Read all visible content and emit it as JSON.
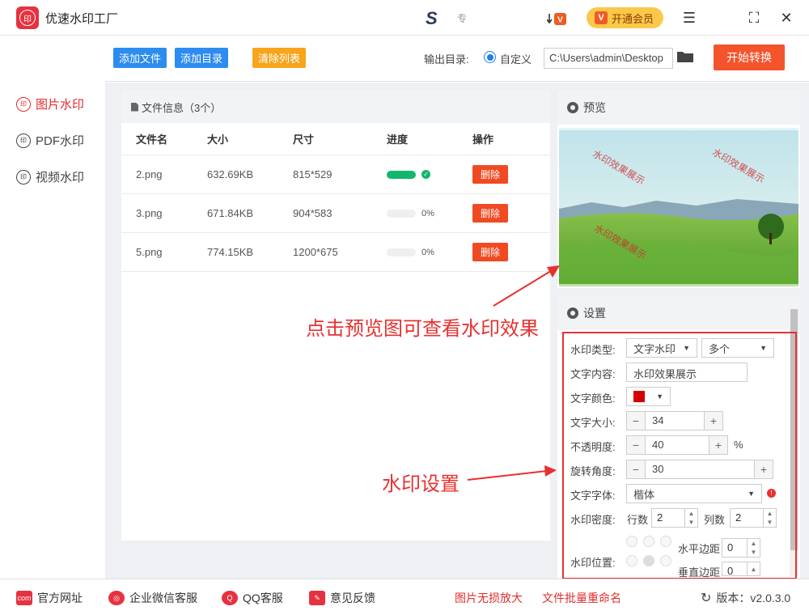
{
  "app": {
    "title": "优速水印工厂",
    "center_logo": "S",
    "center_text": "专"
  },
  "header": {
    "vip_label": "开通会员",
    "vip_badge": "V"
  },
  "sidebar": {
    "items": [
      {
        "label": "图片水印",
        "icon": "印",
        "active": true
      },
      {
        "label": "PDF水印",
        "icon": "印",
        "active": false
      },
      {
        "label": "视频水印",
        "icon": "印",
        "active": false
      }
    ]
  },
  "toolbar": {
    "add_file": "添加文件",
    "add_dir": "添加目录",
    "clear_list": "清除列表",
    "output_label": "输出目录:",
    "radio_label": "自定义",
    "output_path": "C:\\Users\\admin\\Desktop",
    "start": "开始转换"
  },
  "files": {
    "title": "文件信息（3个）",
    "columns": [
      "文件名",
      "大小",
      "尺寸",
      "进度",
      "操作"
    ],
    "rows": [
      {
        "name": "2.png",
        "size": "632.69KB",
        "dim": "815*529",
        "progress": 1.0,
        "pct": "",
        "action": "删除"
      },
      {
        "name": "3.png",
        "size": "671.84KB",
        "dim": "904*583",
        "progress": 0,
        "pct": "0%",
        "action": "删除"
      },
      {
        "name": "5.png",
        "size": "774.15KB",
        "dim": "1200*675",
        "progress": 0,
        "pct": "0%",
        "action": "删除"
      }
    ]
  },
  "preview": {
    "title": "预览",
    "watermark": "水印效果展示"
  },
  "settings": {
    "title": "设置",
    "type_label": "水印类型:",
    "type_value": "文字水印",
    "mode_value": "多个",
    "content_label": "文字内容:",
    "content_value": "水印效果展示",
    "color_label": "文字颜色:",
    "color_value": "#d40000",
    "size_label": "文字大小:",
    "size_value": "34",
    "opacity_label": "不透明度:",
    "opacity_value": "40",
    "opacity_unit": "%",
    "rotate_label": "旋转角度:",
    "rotate_value": "30",
    "font_label": "文字字体:",
    "font_value": "楷体",
    "density_label": "水印密度:",
    "rows_label": "行数",
    "rows_value": "2",
    "cols_label": "列数",
    "cols_value": "2",
    "position_label": "水印位置:",
    "hmargin_label": "水平边距",
    "hmargin_value": "0",
    "vmargin_label": "垂直边距",
    "vmargin_value": "0"
  },
  "annotations": {
    "preview_hint": "点击预览图可查看水印效果",
    "settings_hint": "水印设置"
  },
  "footer": {
    "website": "官方网址",
    "wechat": "企业微信客服",
    "qq": "QQ客服",
    "feedback": "意见反馈",
    "link1": "图片无损放大",
    "link2": "文件批量重命名",
    "version": "版本：v2.0.3.0"
  }
}
